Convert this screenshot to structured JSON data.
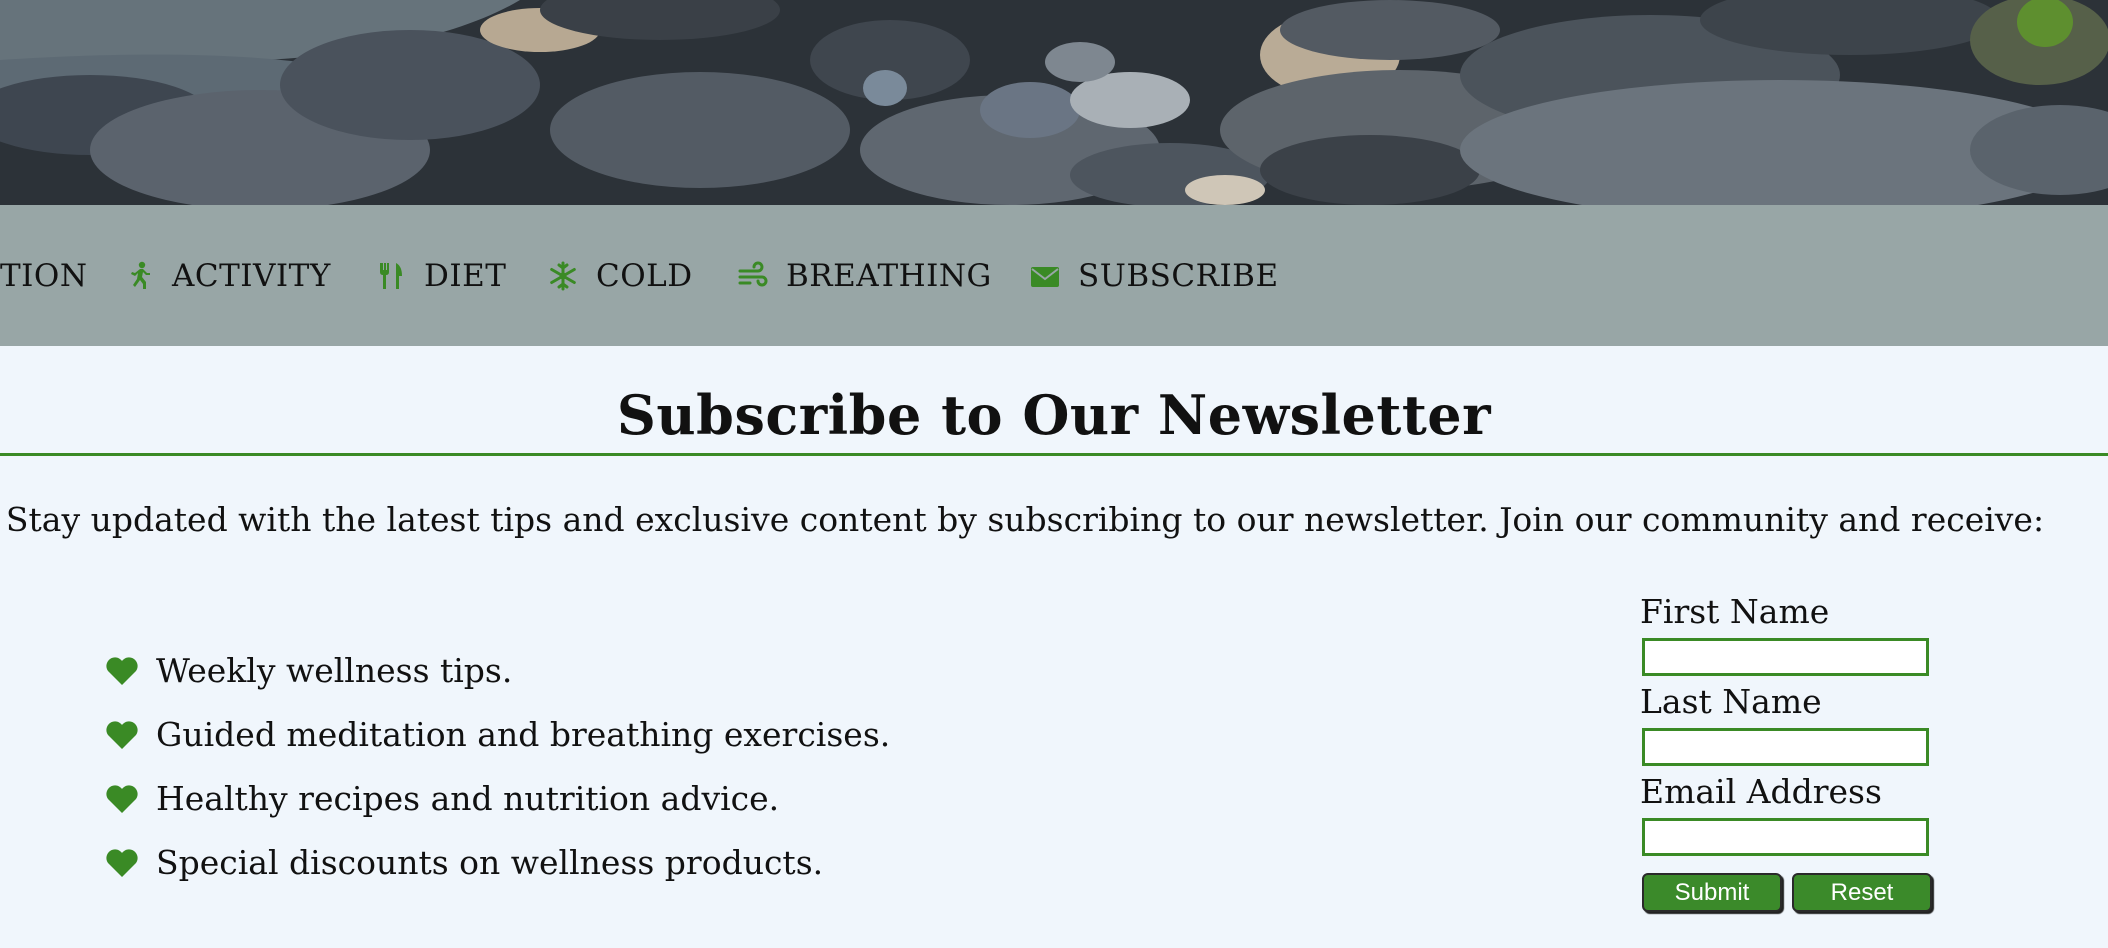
{
  "colors": {
    "accent": "#3a8a25",
    "nav_background": "#98a6a6",
    "page_background": "#f0f6fc"
  },
  "nav": {
    "items": [
      {
        "label": "TION",
        "icon": null
      },
      {
        "label": "ACTIVITY",
        "icon": "running-person-icon"
      },
      {
        "label": "DIET",
        "icon": "utensils-icon"
      },
      {
        "label": "COLD",
        "icon": "snowflake-icon"
      },
      {
        "label": "BREATHING",
        "icon": "wind-icon"
      },
      {
        "label": "SUBSCRIBE",
        "icon": "envelope-icon"
      }
    ]
  },
  "main": {
    "title": "Subscribe to Our Newsletter",
    "intro": "Stay updated with the latest tips and exclusive content by subscribing to our newsletter. Join our community and receive:",
    "benefits": [
      "Weekly wellness tips.",
      "Guided meditation and breathing exercises.",
      "Healthy recipes and nutrition advice.",
      "Special discounts on wellness products."
    ],
    "benefit_icon": "heart-icon"
  },
  "form": {
    "first_name_label": "First Name",
    "first_name_value": "",
    "last_name_label": "Last Name",
    "last_name_value": "",
    "email_label": "Email Address",
    "email_value": "",
    "submit_label": "Submit",
    "reset_label": "Reset"
  }
}
